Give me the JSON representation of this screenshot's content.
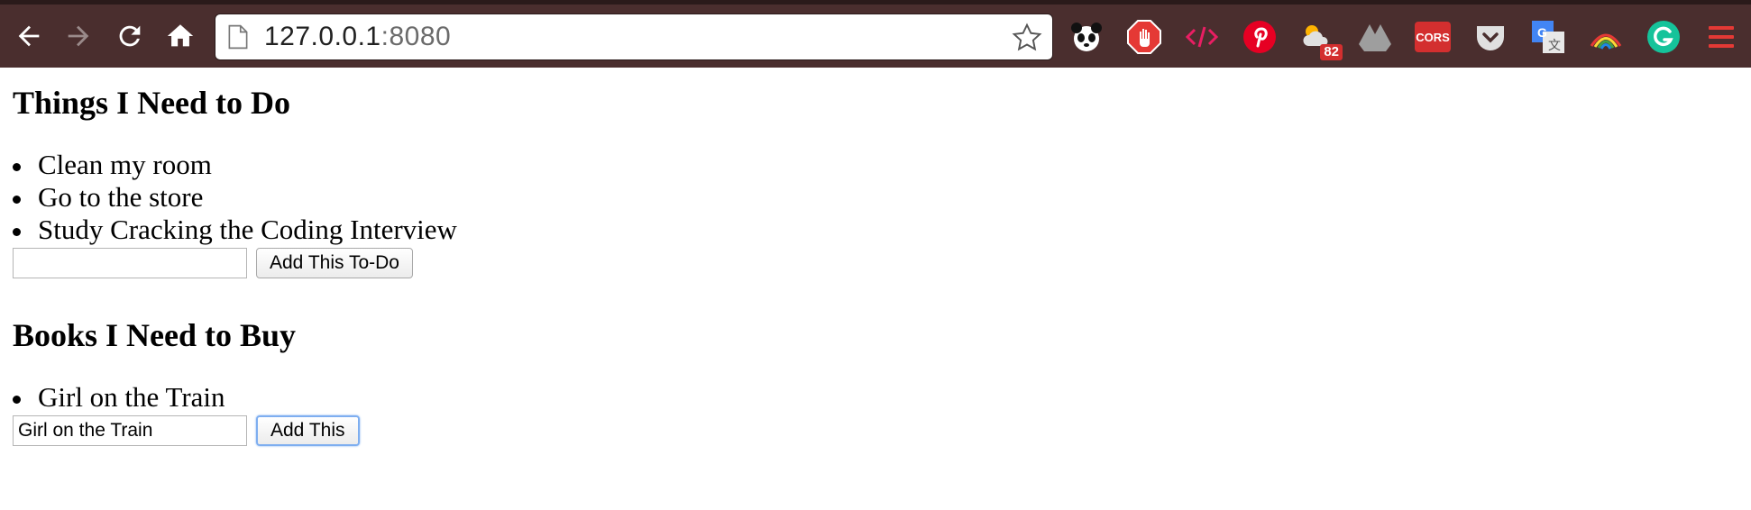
{
  "browser": {
    "url_host": "127.0.0.1",
    "url_port": ":8080",
    "weather_badge": "82",
    "cors_label": "CORS",
    "toolbar_color": "#4a2e2e",
    "extensions": [
      "panda-icon",
      "stop-hand-icon",
      "code-icon",
      "pinterest-icon",
      "weather-icon",
      "google-drive-icon",
      "cors-icon",
      "pocket-icon",
      "google-translate-icon",
      "rainbow-icon",
      "grammarly-icon",
      "chrome-menu-icon"
    ]
  },
  "todos": {
    "heading": "Things I Need to Do",
    "items": [
      "Clean my room",
      "Go to the store",
      "Study Cracking the Coding Interview"
    ],
    "input_value": "",
    "button_label": "Add This To-Do"
  },
  "books": {
    "heading": "Books I Need to Buy",
    "items": [
      "Girl on the Train"
    ],
    "input_value": "Girl on the Train",
    "button_label": "Add This"
  }
}
